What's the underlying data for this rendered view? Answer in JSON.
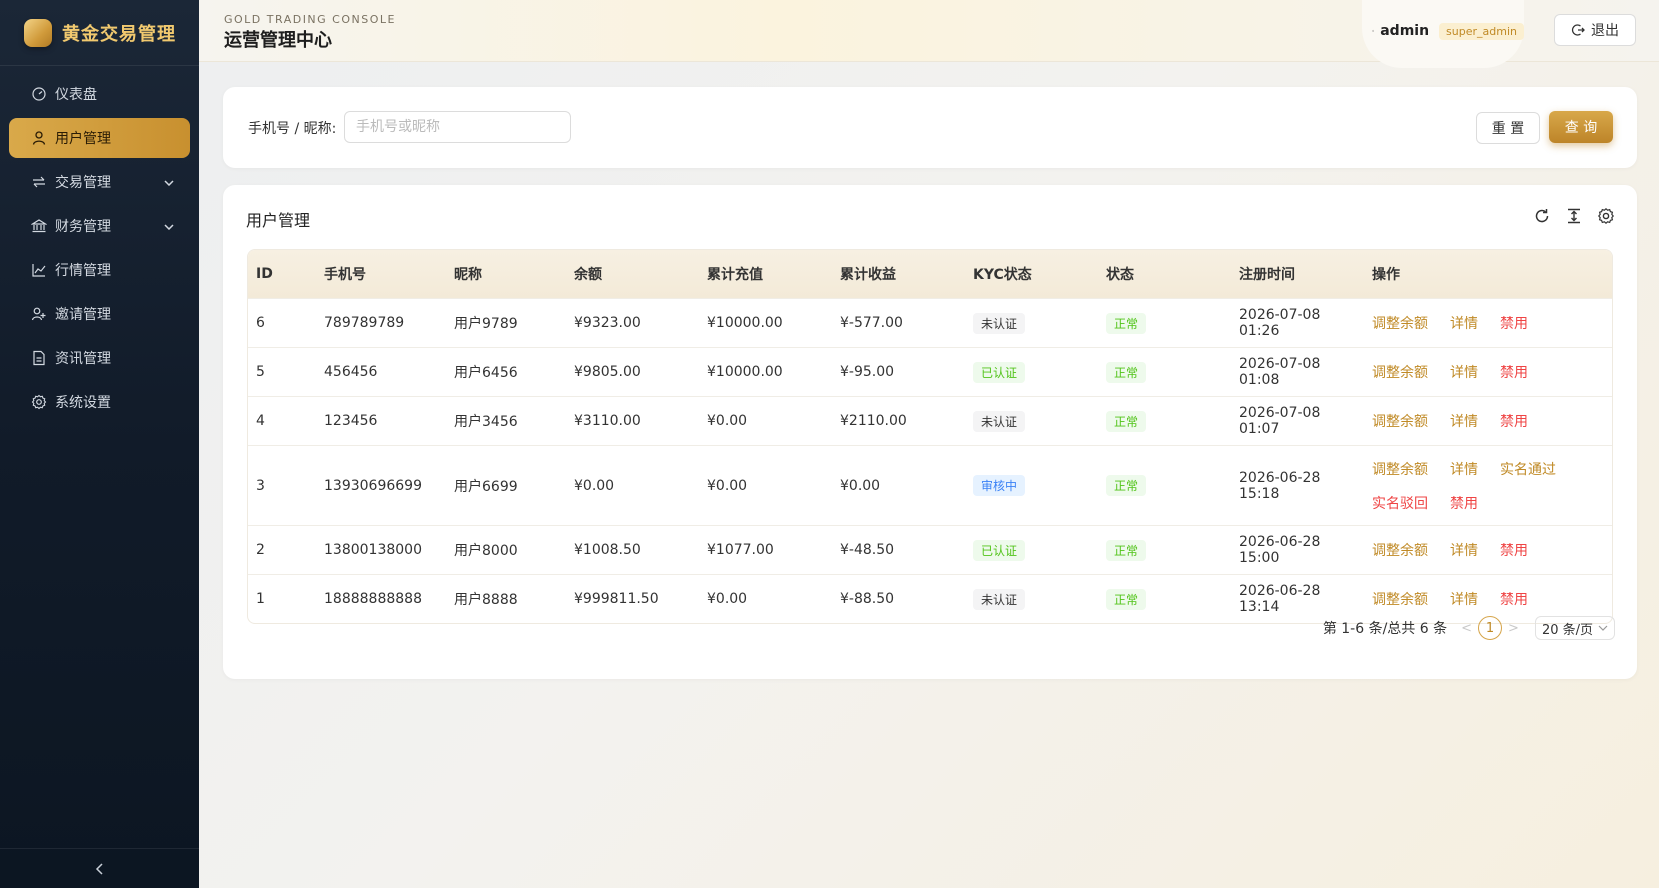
{
  "brand": {
    "name": "黄金交易管理"
  },
  "menu": [
    {
      "label": "仪表盘",
      "icon": "gauge-icon",
      "active": false,
      "expandable": false
    },
    {
      "label": "用户管理",
      "icon": "user-icon",
      "active": true,
      "expandable": false
    },
    {
      "label": "交易管理",
      "icon": "swap-icon",
      "active": false,
      "expandable": true
    },
    {
      "label": "财务管理",
      "icon": "bank-icon",
      "active": false,
      "expandable": true
    },
    {
      "label": "行情管理",
      "icon": "line-chart-icon",
      "active": false,
      "expandable": false
    },
    {
      "label": "邀请管理",
      "icon": "user-add-icon",
      "active": false,
      "expandable": false
    },
    {
      "label": "资讯管理",
      "icon": "document-icon",
      "active": false,
      "expandable": false
    },
    {
      "label": "系统设置",
      "icon": "gear-icon",
      "active": false,
      "expandable": false
    }
  ],
  "header": {
    "en_title": "GOLD TRADING CONSOLE",
    "cn_title": "运营管理中心",
    "username": "admin",
    "role": "super_admin",
    "logout": "退出"
  },
  "search": {
    "label": "手机号 / 昵称:",
    "placeholder": "手机号或昵称",
    "value": "",
    "reset": "重 置",
    "query": "查 询"
  },
  "table": {
    "title": "用户管理",
    "columns": [
      "ID",
      "手机号",
      "昵称",
      "余额",
      "累计充值",
      "累计收益",
      "KYC状态",
      "状态",
      "注册时间",
      "操作"
    ],
    "rows": [
      {
        "id": "6",
        "phone": "789789789",
        "nick": "用户9789",
        "balance": "¥9323.00",
        "deposit": "¥10000.00",
        "profit": "¥-577.00",
        "kyc": "未认证",
        "status": "正常",
        "time": "2026-07-08 01:26",
        "ops": [
          "调整余额",
          "详情",
          "禁用"
        ]
      },
      {
        "id": "5",
        "phone": "456456",
        "nick": "用户6456",
        "balance": "¥9805.00",
        "deposit": "¥10000.00",
        "profit": "¥-95.00",
        "kyc": "已认证",
        "status": "正常",
        "time": "2026-07-08 01:08",
        "ops": [
          "调整余额",
          "详情",
          "禁用"
        ]
      },
      {
        "id": "4",
        "phone": "123456",
        "nick": "用户3456",
        "balance": "¥3110.00",
        "deposit": "¥0.00",
        "profit": "¥2110.00",
        "kyc": "未认证",
        "status": "正常",
        "time": "2026-07-08 01:07",
        "ops": [
          "调整余额",
          "详情",
          "禁用"
        ]
      },
      {
        "id": "3",
        "phone": "13930696699",
        "nick": "用户6699",
        "balance": "¥0.00",
        "deposit": "¥0.00",
        "profit": "¥0.00",
        "kyc": "审核中",
        "status": "正常",
        "time": "2026-06-28 15:18",
        "ops": [
          "调整余额",
          "详情",
          "实名通过",
          "实名驳回",
          "禁用"
        ]
      },
      {
        "id": "2",
        "phone": "13800138000",
        "nick": "用户8000",
        "balance": "¥1008.50",
        "deposit": "¥1077.00",
        "profit": "¥-48.50",
        "kyc": "已认证",
        "status": "正常",
        "time": "2026-06-28 15:00",
        "ops": [
          "调整余额",
          "详情",
          "禁用"
        ]
      },
      {
        "id": "1",
        "phone": "18888888888",
        "nick": "用户8888",
        "balance": "¥999811.50",
        "deposit": "¥0.00",
        "profit": "¥-88.50",
        "kyc": "未认证",
        "status": "正常",
        "time": "2026-06-28 13:14",
        "ops": [
          "调整余额",
          "详情",
          "禁用"
        ]
      }
    ]
  },
  "pagination": {
    "summary": "第 1-6 条/总共 6 条",
    "current_page": "1",
    "page_size": "20 条/页"
  },
  "colors": {
    "gold": "#c08a26",
    "sidebar": "#111b29",
    "danger": "#ef4444",
    "success": "#52c41a"
  }
}
